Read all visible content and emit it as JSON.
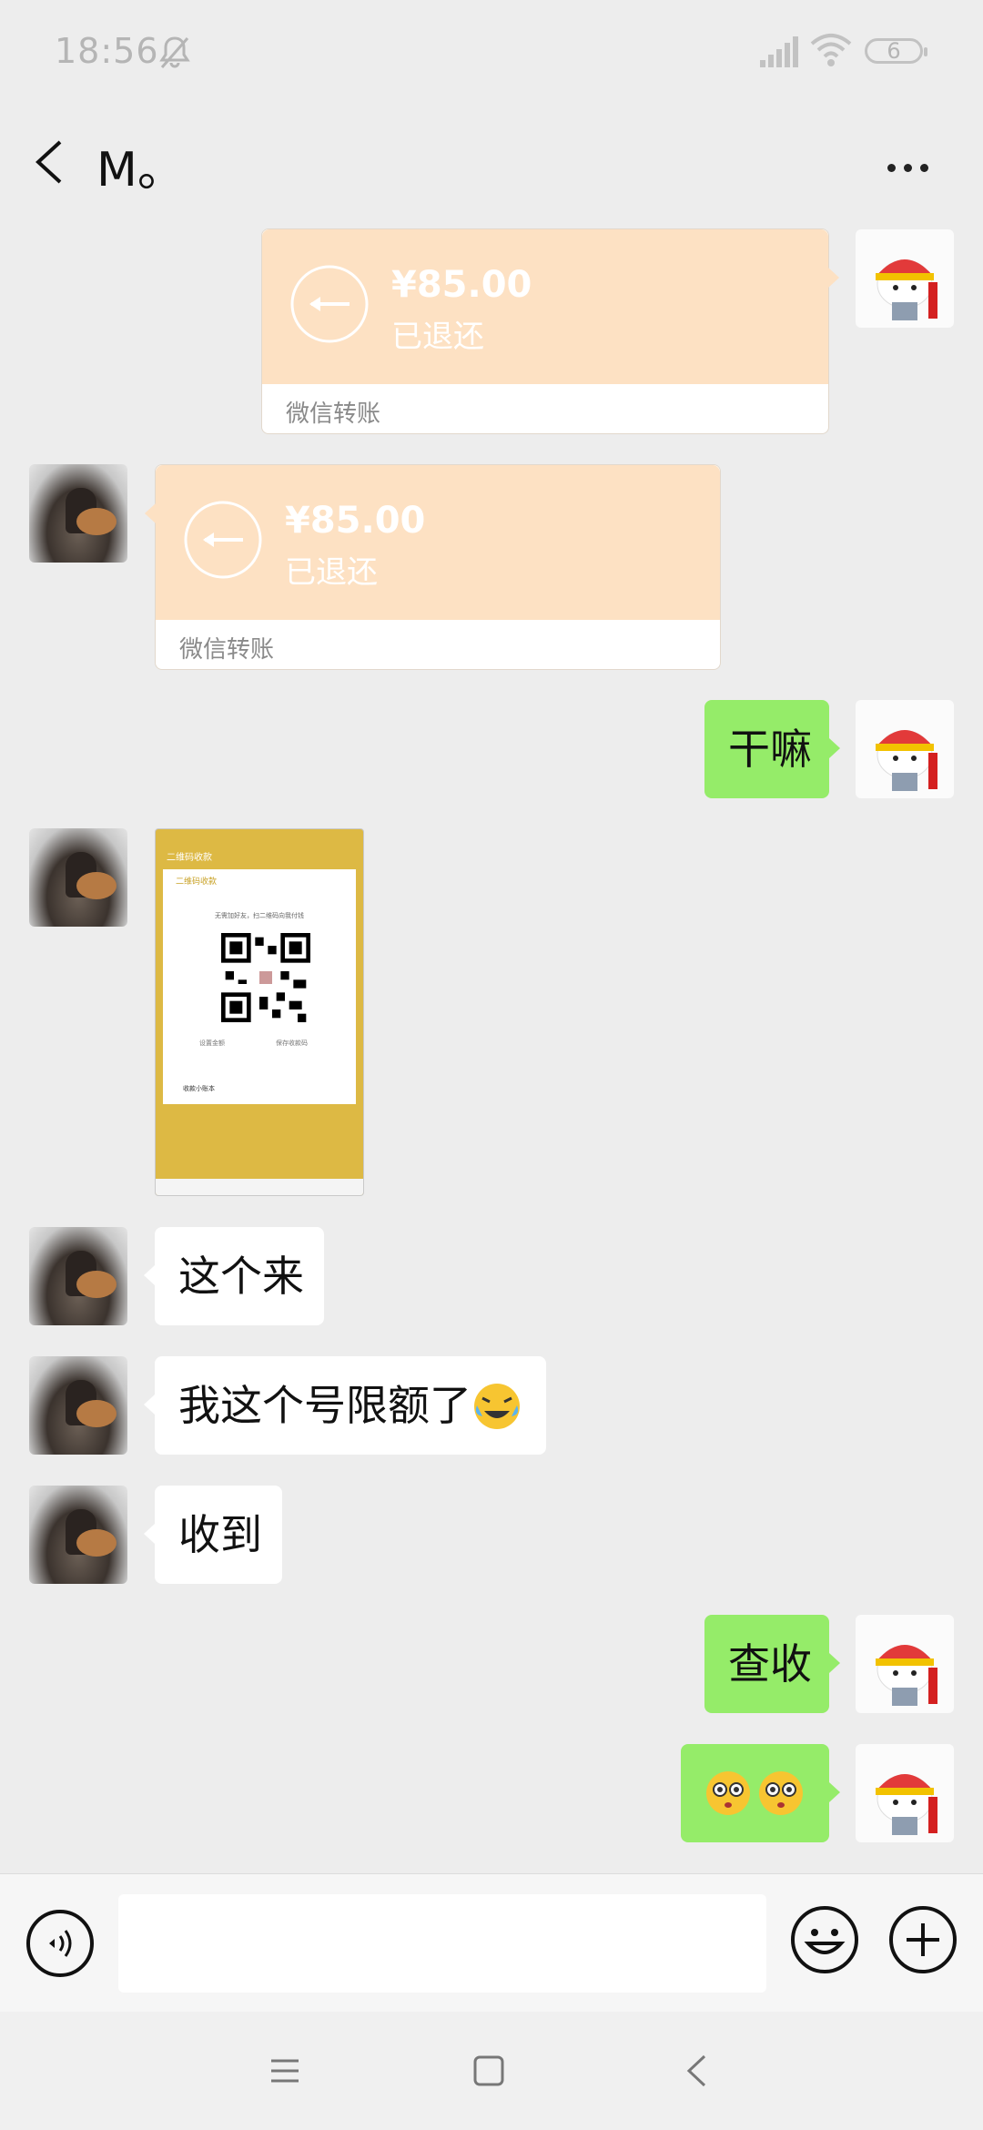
{
  "status_bar": {
    "time": "18:56",
    "battery": "6"
  },
  "header": {
    "title": "M。"
  },
  "messages": {
    "transfer1": {
      "amount": "¥85.00",
      "state": "已退还",
      "label": "微信转账"
    },
    "transfer2": {
      "amount": "¥85.00",
      "state": "已退还",
      "label": "微信转账"
    },
    "m1": "干嘛",
    "qr_image": {
      "header": "二维码收款",
      "hint": "无需加好友，扫二维码向我付钱",
      "set_amount": "设置金额",
      "save_code": "保存收款码",
      "ledger": "收款小账本"
    },
    "m2": "这个来",
    "m3": "我这个号限额了",
    "m4": "收到",
    "m5": "查收"
  },
  "input_bar": {
    "placeholder": ""
  },
  "colors": {
    "accent_green": "#95ec69",
    "transfer_orange": "#fde1c3",
    "background": "#ededed"
  },
  "icons": {
    "silent": "bell-off-icon",
    "signal": "signal-icon",
    "wifi": "wifi-icon",
    "back": "chevron-left-icon",
    "more": "more-dots-icon",
    "voice": "voice-icon",
    "emoji": "emoji-icon",
    "plus": "plus-icon",
    "nav_menu": "menu-icon",
    "nav_home": "home-icon",
    "nav_back": "back-icon"
  }
}
